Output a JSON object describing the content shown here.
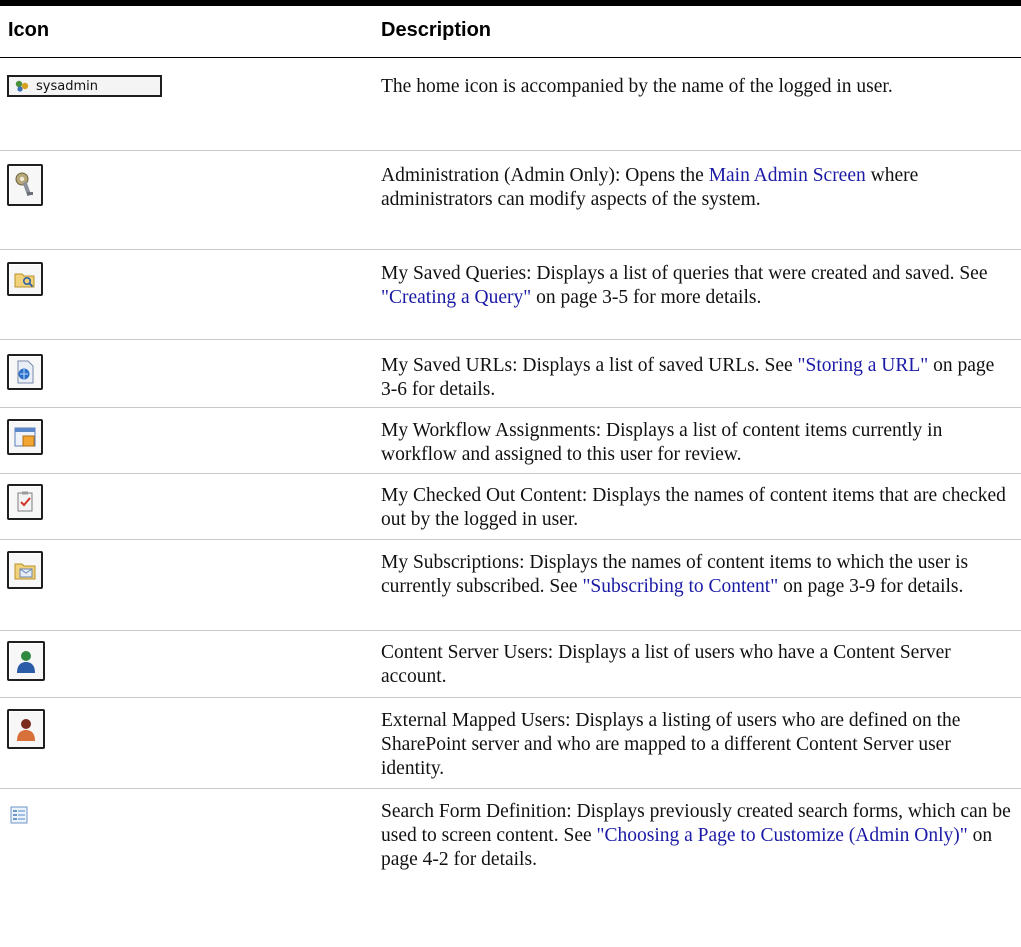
{
  "header": {
    "icon_col": "Icon",
    "desc_col": "Description"
  },
  "rows": [
    {
      "icon": "home-icon",
      "icon_label": "sysadmin",
      "parts": [
        {
          "t": "The home icon is accompanied by the name of the logged in user."
        }
      ]
    },
    {
      "icon": "administration-icon",
      "parts": [
        {
          "t": "Administration (Admin Only): Opens the "
        },
        {
          "t": "Main Admin Screen",
          "link": true
        },
        {
          "t": " where administrators can modify aspects of the system."
        }
      ]
    },
    {
      "icon": "saved-queries-icon",
      "parts": [
        {
          "t": "My Saved Queries: Displays a list of queries that were created and saved. See "
        },
        {
          "t": "\"Creating a Query\"",
          "link": true
        },
        {
          "t": " on page 3-5 for more details."
        }
      ]
    },
    {
      "icon": "saved-urls-icon",
      "parts": [
        {
          "t": "My Saved URLs: Displays a list of saved URLs. See "
        },
        {
          "t": "\"Storing a URL\"",
          "link": true
        },
        {
          "t": " on page 3-6 for details."
        }
      ]
    },
    {
      "icon": "workflow-assignments-icon",
      "parts": [
        {
          "t": "My Workflow Assignments: Displays a list of content items currently in workflow and assigned to this user for review."
        }
      ]
    },
    {
      "icon": "checked-out-content-icon",
      "parts": [
        {
          "t": "My Checked Out Content: Displays the names of content items that are checked out by the logged in user."
        }
      ]
    },
    {
      "icon": "subscriptions-icon",
      "parts": [
        {
          "t": "My Subscriptions: Displays the names of content items to which the user is currently subscribed. See "
        },
        {
          "t": "\"Subscribing to Content\"",
          "link": true
        },
        {
          "t": " on page 3-9 for details."
        }
      ]
    },
    {
      "icon": "content-server-users-icon",
      "parts": [
        {
          "t": "Content Server Users: Displays a list of users who have a Content Server account."
        }
      ]
    },
    {
      "icon": "external-mapped-users-icon",
      "parts": [
        {
          "t": "External Mapped Users: Displays a listing of users who are defined on the SharePoint server and who are mapped to a different Content Server user identity."
        }
      ]
    },
    {
      "icon": "search-form-definition-icon",
      "parts": [
        {
          "t": "Search Form Definition: Displays previously created search forms, which can be used to screen content. See "
        },
        {
          "t": "\"Choosing a Page to Customize (Admin Only)\"",
          "link": true
        },
        {
          "t": " on page 4-2 for details."
        }
      ]
    }
  ]
}
